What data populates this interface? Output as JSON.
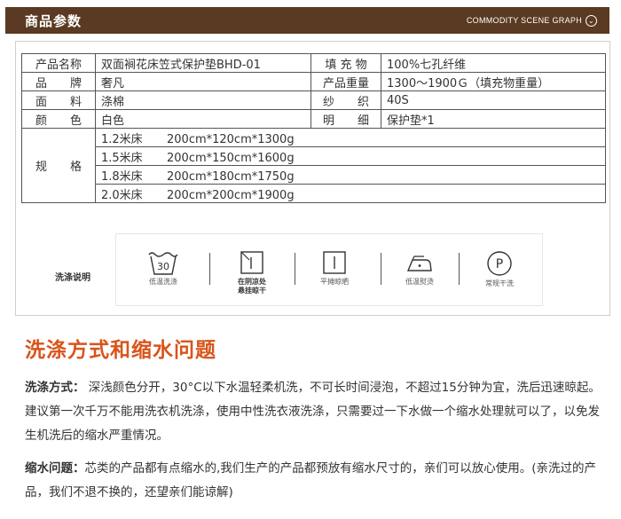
{
  "header": {
    "title": "商品参数",
    "subtitle": "COMMODITY SCENE GRAPH"
  },
  "spec": {
    "rows": [
      {
        "label1": "产品名称",
        "value1": "双面裥花床笠式保护垫BHD-01",
        "label2": "填 充 物",
        "value2": "100%七孔纤维"
      },
      {
        "label1": "品　　牌",
        "value1": "奢凡",
        "label2": "产品重量",
        "value2": "1300～1900Ｇ（填充物重量）"
      },
      {
        "label1": "面　　料",
        "value1": "涤棉",
        "label2": "纱　　织",
        "value2": "40S"
      },
      {
        "label1": "颜　　色",
        "value1": "白色",
        "label2": "明　　细",
        "value2": "保护垫*1"
      }
    ],
    "size_label": "规　　格",
    "sizes": [
      {
        "name": "1.2米床",
        "dims": "200cm*120cm*1300g"
      },
      {
        "name": "1.5米床",
        "dims": "200cm*150cm*1600g"
      },
      {
        "name": "1.8米床",
        "dims": "200cm*180cm*1750g"
      },
      {
        "name": "2.0米床",
        "dims": "200cm*200cm*1900g"
      }
    ]
  },
  "care": {
    "title": "洗涤说明",
    "items": [
      {
        "icon": "wash-30-icon",
        "symbol": "30",
        "caption": "低温洗涤"
      },
      {
        "icon": "hang-dry-shade-icon",
        "caption": "在阴凉处",
        "caption2": "悬挂晾干"
      },
      {
        "icon": "flat-dry-icon",
        "caption": "平摊晾晒"
      },
      {
        "icon": "low-iron-icon",
        "caption": "低温熨烫"
      },
      {
        "icon": "dry-clean-p-icon",
        "symbol": "P",
        "caption": "常规干洗"
      }
    ]
  },
  "section": {
    "title": "洗涤方式和缩水问题",
    "wash_label": "洗涤方式：",
    "wash_text": " 深浅颜色分开，30°C以下水温轻柔机洗，不可长时间浸泡，不超过15分钟为宜，洗后迅速晾起。建议第一次千万不能用洗衣机洗涤，使用中性洗衣液洗涤，只需要过一下水做一个缩水处理就可以了，以免发生机洗后的缩水严重情况。",
    "shrink_label": "缩水问题：",
    "shrink_text": "芯类的产品都有点缩水的,我们生产的产品都预放有缩水尺寸的，亲们可以放心使用。(亲洗过的产品，我们不退不换的，还望亲们能谅解)"
  }
}
